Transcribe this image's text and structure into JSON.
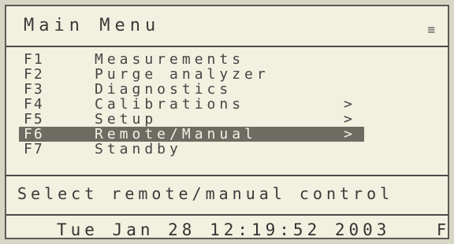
{
  "header": {
    "title": "Main Menu",
    "menu_icon": "list-icon"
  },
  "menu": {
    "items": [
      {
        "key": "F1",
        "label": "Measurements",
        "arrow": ""
      },
      {
        "key": "F2",
        "label": "Purge analyzer",
        "arrow": ""
      },
      {
        "key": "F3",
        "label": "Diagnostics",
        "arrow": ""
      },
      {
        "key": "F4",
        "label": "Calibrations",
        "arrow": ">"
      },
      {
        "key": "F5",
        "label": "Setup",
        "arrow": ">"
      },
      {
        "key": "F6",
        "label": "Remote/Manual",
        "arrow": ">"
      },
      {
        "key": "F7",
        "label": "Standby",
        "arrow": ""
      }
    ],
    "selected_key": "F6"
  },
  "status": {
    "message": "Select remote/manual control"
  },
  "footer": {
    "datetime": "Tue Jan 28 12:19:52 2003",
    "corner": "F"
  },
  "colors": {
    "background": "#f2f0df",
    "text": "#3a3a3a",
    "selection": "#6e6c62"
  }
}
